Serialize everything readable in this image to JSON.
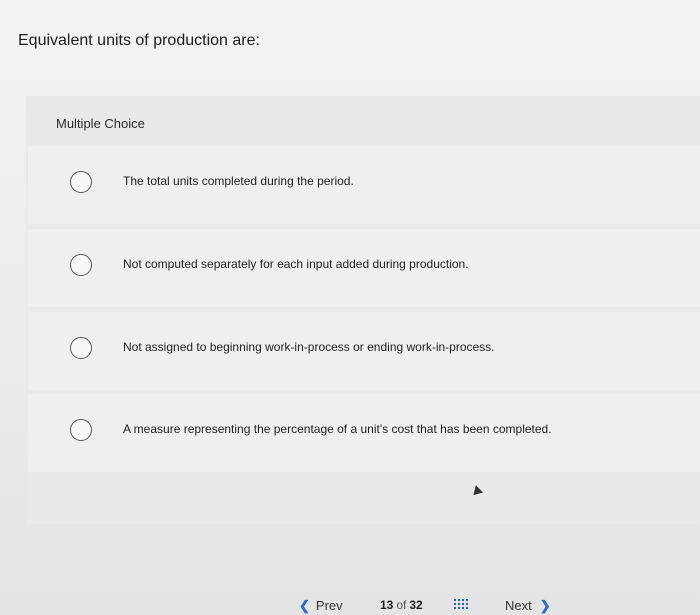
{
  "question": {
    "text": "Equivalent units of production are:"
  },
  "multiple_choice": {
    "header": "Multiple Choice",
    "options": [
      {
        "label": "The total units completed during the period.",
        "selected": false
      },
      {
        "label": "Not computed separately for each input added during production.",
        "selected": false
      },
      {
        "label": "Not assigned to beginning work-in-process or ending work-in-process.",
        "selected": false
      },
      {
        "label": "A measure representing the percentage of a unit's cost that has been completed.",
        "selected": false
      }
    ]
  },
  "navigation": {
    "prev_label": "Prev",
    "next_label": "Next",
    "current_page": "13",
    "of_label": "of",
    "total_pages": "32",
    "prev_icon": "chevron-left-icon",
    "next_icon": "chevron-right-icon",
    "grid_icon": "grid-icon",
    "accent_color": "#2b6bd9"
  }
}
